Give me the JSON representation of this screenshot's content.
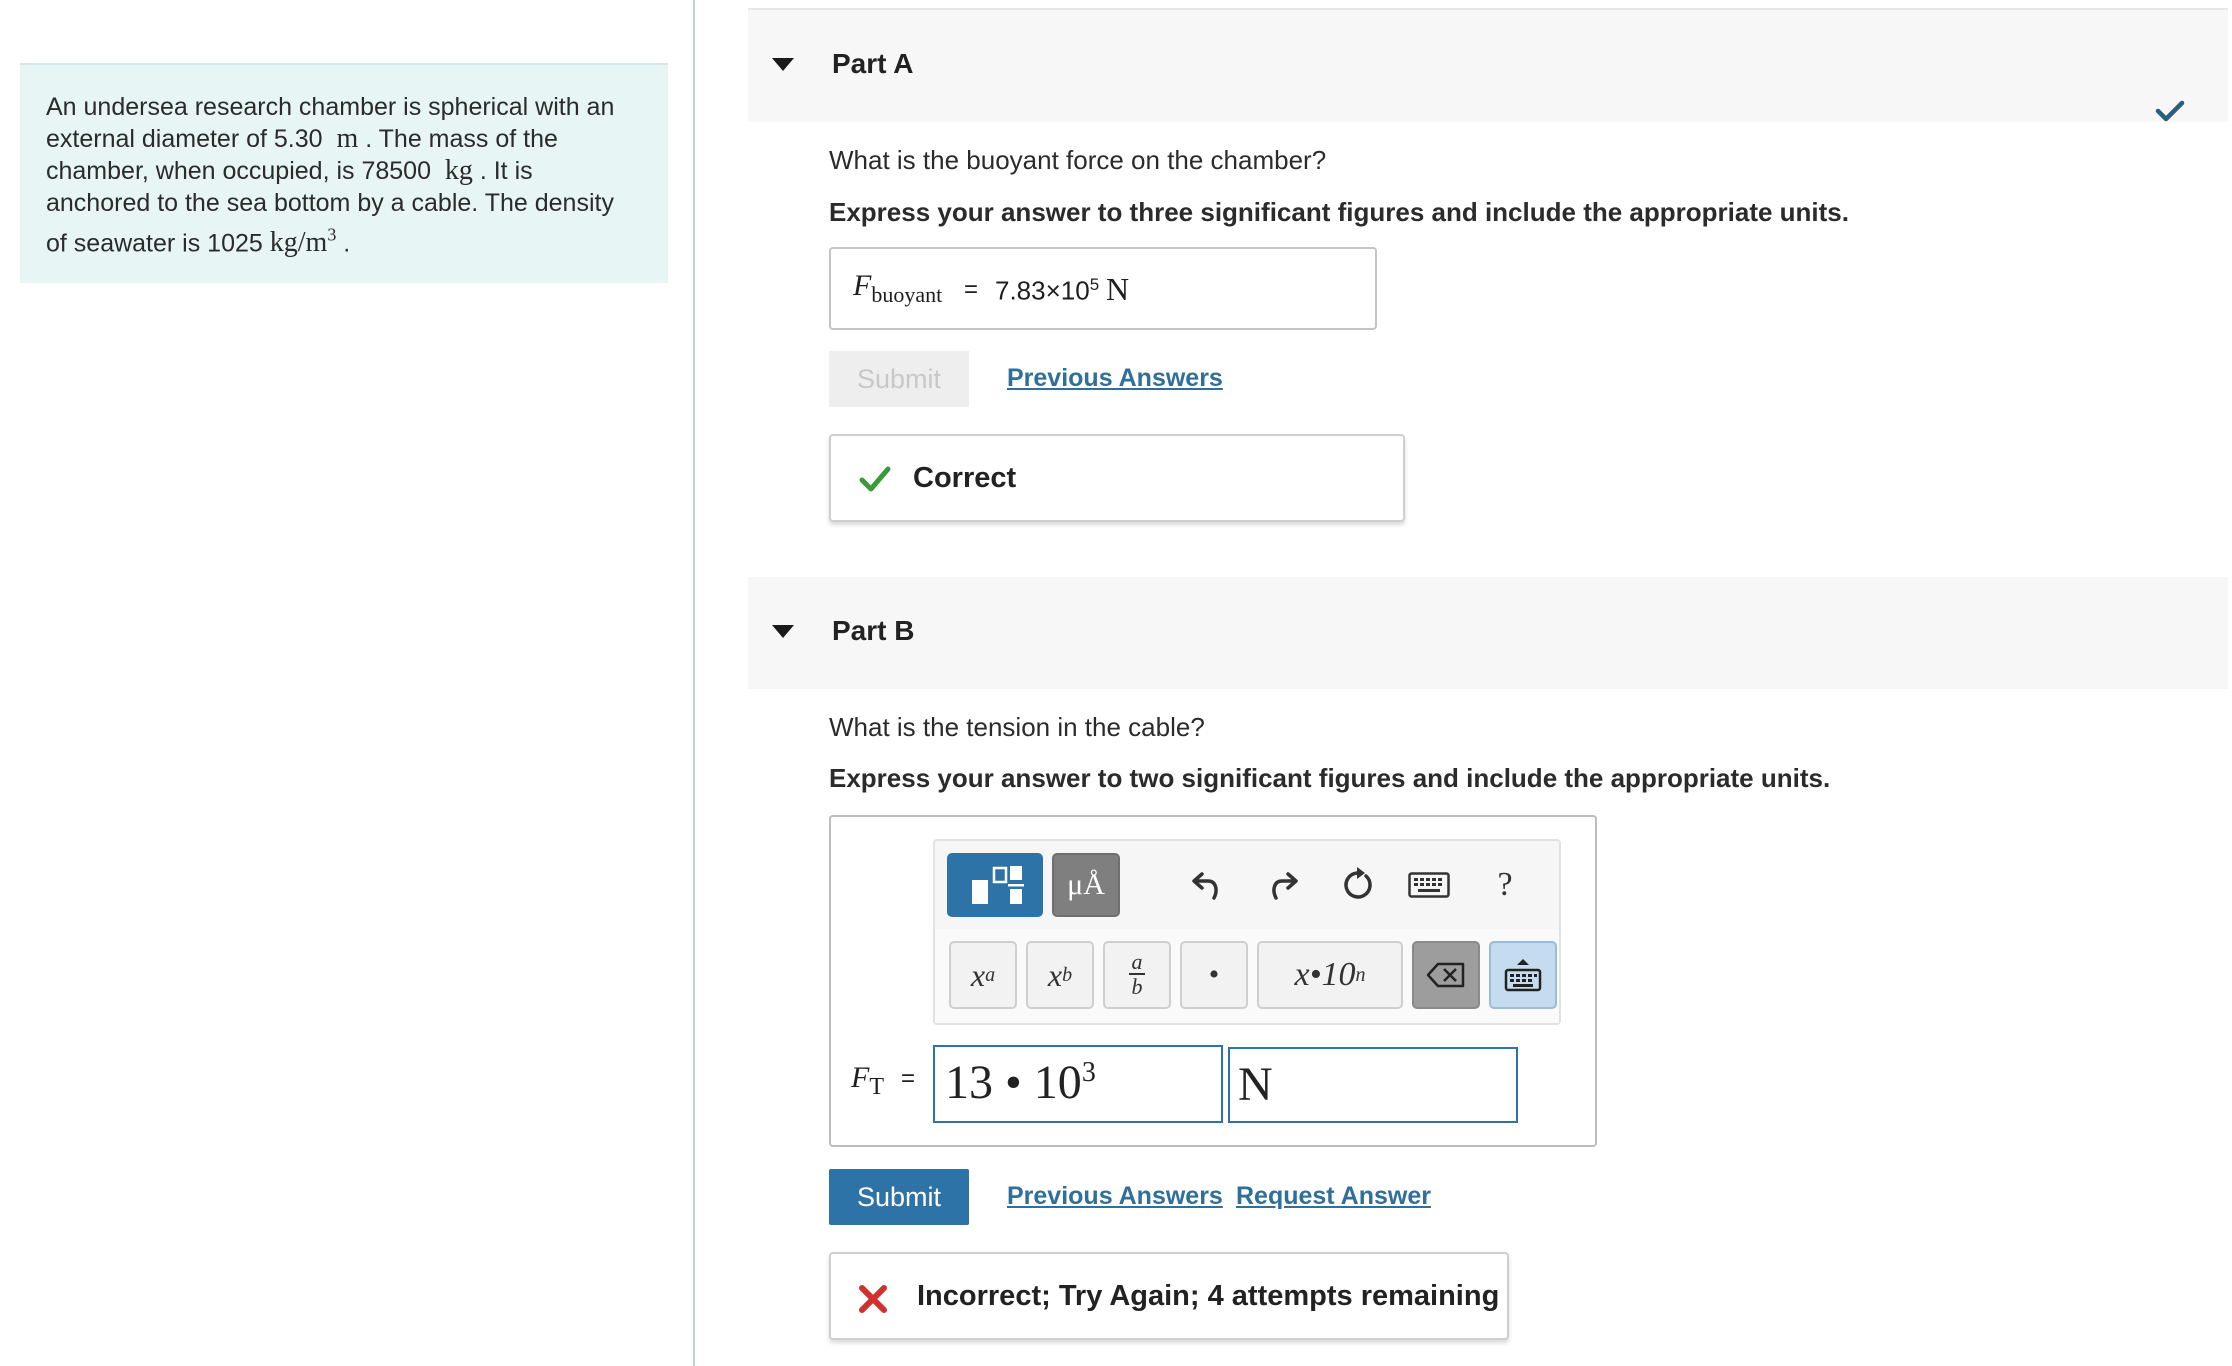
{
  "problem": {
    "line1": "An undersea research chamber is spherical with an",
    "line2_pre": "external diameter of 5.30",
    "line2_unit": "m",
    "line2_post": ". The mass of the",
    "line3_pre": "chamber, when occupied, is 78500",
    "line3_unit": "kg",
    "line3_post": ". It is",
    "line4": "anchored to the sea bottom by a cable. The density",
    "line5_pre": "of seawater is 1025",
    "line5_unit": "kg/m",
    "line5_exp": "3",
    "line5_post": "."
  },
  "part_a": {
    "title": "Part A",
    "question": "What is the buoyant force on the chamber?",
    "instruction": "Express your answer to three significant figures and include the appropriate units.",
    "answer_symbol": "F",
    "answer_subscript": "buoyant",
    "equals": "=",
    "answer_mantissa": "7.83×10",
    "answer_exponent": "5",
    "answer_unit": "N",
    "submit_label": "Submit",
    "previous_answers_label": "Previous Answers",
    "feedback": "Correct"
  },
  "part_b": {
    "title": "Part B",
    "question": "What is the tension in the cable?",
    "instruction": "Express your answer to two significant figures and include the appropriate units.",
    "toolbar": {
      "units_label": "μÅ",
      "help_label": "?",
      "superscript_x": "x",
      "superscript_a": "a",
      "subscript_x": "x",
      "subscript_b": "b",
      "fraction_num": "a",
      "fraction_den": "b",
      "dot_label": "•",
      "sci_label": "x•10",
      "sci_exp": "n"
    },
    "answer_symbol": "F",
    "answer_subscript": "T",
    "equals": "=",
    "value_mantissa": "13 • 10",
    "value_exponent": "3",
    "unit_value": "N",
    "submit_label": "Submit",
    "previous_answers_label": "Previous Answers",
    "request_answer_label": "Request Answer",
    "feedback": "Incorrect; Try Again; 4 attempts remaining"
  }
}
